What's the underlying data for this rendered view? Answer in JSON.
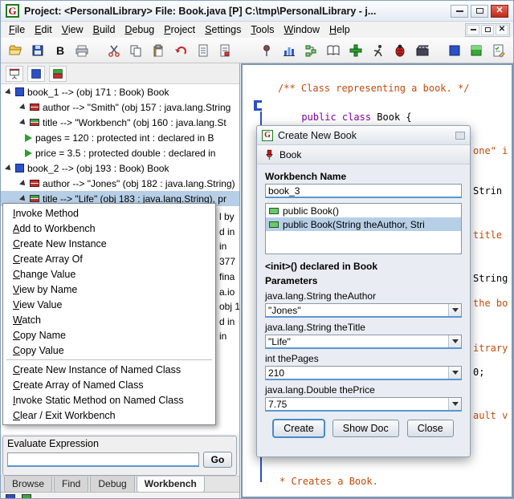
{
  "window": {
    "title": "Project: <PersonalLibrary>    File: Book.java [P]  C:\\tmp\\PersonalLibrary - j...",
    "logo_letter": "G"
  },
  "menubar": {
    "items": [
      "File",
      "Edit",
      "View",
      "Build",
      "Debug",
      "Project",
      "Settings",
      "Tools",
      "Window",
      "Help"
    ]
  },
  "toolbar": {
    "icons": [
      "open-folder",
      "save",
      "bold-b",
      "print",
      "cut",
      "copy",
      "paste",
      "undo",
      "document",
      "document-copy",
      "pin",
      "bar-chart",
      "uml",
      "open-book",
      "add",
      "run",
      "debug-bug",
      "movie",
      "blue-panel",
      "green-panel",
      "tasklist"
    ]
  },
  "left_toolbar": {
    "icons": [
      "presentation",
      "object-view",
      "workbench-view"
    ]
  },
  "workbench": {
    "rows": [
      {
        "label": "book_1 --> (obj 171 : Book)  Book"
      },
      {
        "label": "author --> \"Smith\" (obj 157 : java.lang.String"
      },
      {
        "label": "title --> \"Workbench\" (obj 160 : java.lang.St"
      },
      {
        "label": "pages = 120 :  protected int : declared in B"
      },
      {
        "label": "price = 3.5 :  protected double : declared in"
      },
      {
        "label": "book_2 --> (obj 193 : Book)  Book"
      },
      {
        "label": "author --> \"Jones\" (obj 182 : java.lang.String)"
      },
      {
        "label": "title --> \"Life\" (obj 183 : java.lang.String), pr"
      }
    ],
    "obscured_fragments": [
      "l by",
      "d in",
      "in",
      "377",
      "fina",
      "a.io",
      "obj 1",
      "d in",
      "in"
    ]
  },
  "context_menu": {
    "items": [
      "Invoke Method",
      "Add to Workbench",
      "Create New Instance",
      "Create Array Of",
      "Change Value",
      "View by Name",
      "View Value",
      "Watch",
      "Copy Name",
      "Copy Value",
      "Create New Instance of Named Class",
      "Create Array of Named Class",
      "Invoke Static Method on Named Class",
      "Clear / Exit Workbench"
    ]
  },
  "dialog": {
    "title": "Create New Book",
    "class_name": "Book",
    "workbench_name_label": "Workbench Name",
    "workbench_name_value": "book_3",
    "constructors": [
      "public Book()",
      "public Book(String theAuthor, Stri"
    ],
    "declaration": "<init>() declared in Book",
    "parameters_label": "Parameters",
    "parameters": [
      {
        "type": "java.lang.String theAuthor",
        "value": "\"Jones\""
      },
      {
        "type": "java.lang.String theTitle",
        "value": "\"Life\""
      },
      {
        "type": "int thePages",
        "value": "210"
      },
      {
        "type": "java.lang.Double thePrice",
        "value": "7.75"
      }
    ],
    "buttons": {
      "create": "Create",
      "show_doc": "Show Doc",
      "close": "Close"
    }
  },
  "editor": {
    "comment_line": "/** Class representing a book. */",
    "class_keyword": "public class",
    "class_rest": " Book {",
    "fragments": [
      {
        "text": "one\" i",
        "color": "#c84b0a"
      },
      {
        "text": "Strin",
        "color": "#000000"
      },
      {
        "text": "title",
        "color": "#c84b0a"
      },
      {
        "text": "String",
        "color": "#000000"
      },
      {
        "text": "the bo",
        "color": "#c84b0a"
      },
      {
        "text": "itrary",
        "color": "#c84b0a"
      },
      {
        "text": "0;",
        "color": "#000000"
      },
      {
        "text": "ault v",
        "color": "#c84b0a"
      }
    ],
    "bottom_comment": "* Creates a Book."
  },
  "evaluate": {
    "label": "Evaluate Expression",
    "value": "",
    "go_label": "Go"
  },
  "tabs": {
    "items": [
      "Browse",
      "Find",
      "Debug",
      "Workbench"
    ],
    "active": "Workbench"
  },
  "colors": {
    "comment": "#c84b0a",
    "keyword": "#8400a8",
    "selection": "#b7cfe6",
    "close_button": "#c0281a"
  }
}
